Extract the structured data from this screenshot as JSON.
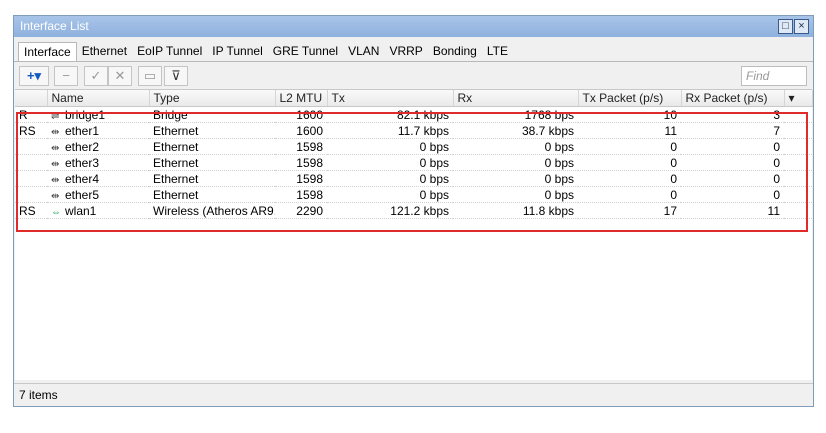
{
  "window": {
    "title": "Interface List"
  },
  "tabs": [
    "Interface",
    "Ethernet",
    "EoIP Tunnel",
    "IP Tunnel",
    "GRE Tunnel",
    "VLAN",
    "VRRP",
    "Bonding",
    "LTE"
  ],
  "toolbar": {
    "find_placeholder": "Find"
  },
  "columns": [
    "Name",
    "Type",
    "L2 MTU",
    "Tx",
    "Rx",
    "Tx Packet (p/s)",
    "Rx Packet (p/s)"
  ],
  "rows": [
    {
      "flag": "R",
      "name": "bridge1",
      "icon": "bridge-icon",
      "type": "Bridge",
      "mtu": "1600",
      "tx": "82.1 kbps",
      "rx": "1768 bps",
      "txp": "10",
      "rxp": "3"
    },
    {
      "flag": "RS",
      "name": "ether1",
      "icon": "ethernet-icon",
      "type": "Ethernet",
      "mtu": "1600",
      "tx": "11.7 kbps",
      "rx": "38.7 kbps",
      "txp": "11",
      "rxp": "7"
    },
    {
      "flag": "",
      "name": "ether2",
      "icon": "ethernet-icon",
      "type": "Ethernet",
      "mtu": "1598",
      "tx": "0 bps",
      "rx": "0 bps",
      "txp": "0",
      "rxp": "0"
    },
    {
      "flag": "",
      "name": "ether3",
      "icon": "ethernet-icon",
      "type": "Ethernet",
      "mtu": "1598",
      "tx": "0 bps",
      "rx": "0 bps",
      "txp": "0",
      "rxp": "0"
    },
    {
      "flag": "",
      "name": "ether4",
      "icon": "ethernet-icon",
      "type": "Ethernet",
      "mtu": "1598",
      "tx": "0 bps",
      "rx": "0 bps",
      "txp": "0",
      "rxp": "0"
    },
    {
      "flag": "",
      "name": "ether5",
      "icon": "ethernet-icon",
      "type": "Ethernet",
      "mtu": "1598",
      "tx": "0 bps",
      "rx": "0 bps",
      "txp": "0",
      "rxp": "0"
    },
    {
      "flag": "RS",
      "name": "wlan1",
      "icon": "wireless-icon",
      "type": "Wireless (Atheros AR9...",
      "mtu": "2290",
      "tx": "121.2 kbps",
      "rx": "11.8 kbps",
      "txp": "17",
      "rxp": "11"
    }
  ],
  "status": {
    "count": "7 items"
  },
  "colors": {
    "highlight": "#e02b2b",
    "titlebar": "#9bbbe3"
  }
}
